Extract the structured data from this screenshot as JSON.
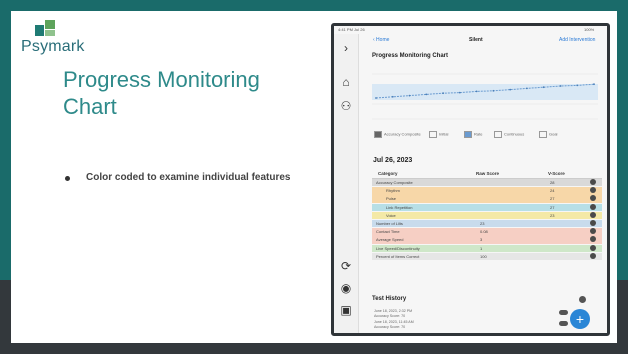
{
  "logo": {
    "word": "Psymark"
  },
  "slide": {
    "title": "Progress Monitoring Chart",
    "bullet": "Color coded to examine individual features"
  },
  "tablet": {
    "status_left": "4:41 PM Jul 26",
    "status_right": "100%",
    "nav_back": "‹ Home",
    "nav_center": "Silent",
    "nav_right": "Add Intervention",
    "chart_title": "Progress Monitoring Chart",
    "legend": [
      "Accuracy Composite",
      "Initial",
      "Rate",
      "Continuous",
      "Goal"
    ],
    "date": "Jul 26, 2023",
    "columns": {
      "category": "Category",
      "raw": "Raw Score",
      "score": "V-Score"
    },
    "rows": [
      {
        "label": "Accuracy Composite",
        "raw": "",
        "score": "28",
        "color": "#d9d9d9",
        "indent": false
      },
      {
        "label": "Rhythm",
        "raw": "",
        "score": "24",
        "color": "#f7d7a8",
        "indent": true
      },
      {
        "label": "Pulse",
        "raw": "",
        "score": "27",
        "color": "#f7d7a8",
        "indent": true
      },
      {
        "label": "Link Repetition",
        "raw": "",
        "score": "27",
        "color": "#b7dfe6",
        "indent": true
      },
      {
        "label": "Voice",
        "raw": "",
        "score": "23",
        "color": "#f4e9a6",
        "indent": true
      },
      {
        "label": "Number of Lilts",
        "raw": "23",
        "score": "",
        "color": "#c8dbec",
        "indent": false
      },
      {
        "label": "Contact Time",
        "raw": "0.08",
        "score": "",
        "color": "#f6cfc4",
        "indent": false
      },
      {
        "label": "Average Speed",
        "raw": "3",
        "score": "",
        "color": "#f6cfc4",
        "indent": false
      },
      {
        "label": "Live Speed/Discontinuity",
        "raw": "1",
        "score": "",
        "color": "#cfe7c9",
        "indent": false
      },
      {
        "label": "Percent of Items Correct",
        "raw": "100",
        "score": "",
        "color": "#e6e6e6",
        "indent": false
      }
    ],
    "history_title": "Test History",
    "history": [
      {
        "line1": "June 18, 2023, 2:32 PM",
        "line2": "Accuracy Score: 70"
      },
      {
        "line1": "June 18, 2023, 11:45 AM",
        "line2": "Accuracy Score: 70"
      }
    ],
    "chart_points": [
      0.1,
      0.12,
      0.14,
      0.16,
      0.18,
      0.19,
      0.21,
      0.22,
      0.24,
      0.26,
      0.28,
      0.3,
      0.31,
      0.33
    ],
    "accent": "#2a86d6",
    "header_bg": "#1a6b6a"
  }
}
